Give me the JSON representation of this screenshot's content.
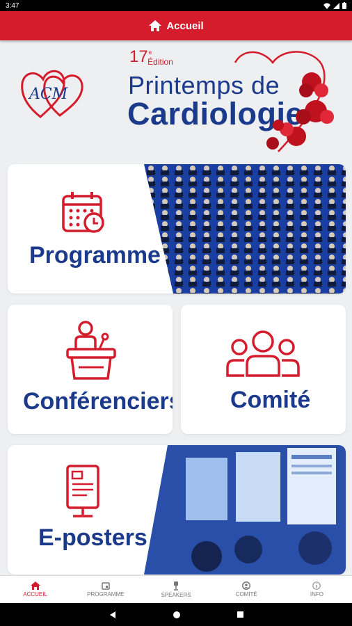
{
  "status_bar": {
    "time": "3:47"
  },
  "app_bar": {
    "title": "Accueil",
    "icon": "home-icon"
  },
  "banner": {
    "edition_number": "17",
    "edition_sup": "e",
    "edition_word": "Édition",
    "title_line1": "Printemps de",
    "title_line2": "Cardiologie",
    "logo_text": "ACM"
  },
  "cards": {
    "programme": {
      "label": "Programme",
      "icon": "calendar-clock-icon"
    },
    "conferenciers": {
      "label": "Conférenciers",
      "icon": "speaker-podium-icon"
    },
    "comite": {
      "label": "Comité",
      "icon": "group-icon"
    },
    "eposters": {
      "label": "E-posters",
      "icon": "poster-kiosk-icon"
    }
  },
  "bottom_nav": [
    {
      "label": "ACCUEIL",
      "icon": "home-icon",
      "active": true
    },
    {
      "label": "PROGRAMME",
      "icon": "calendar-icon",
      "active": false
    },
    {
      "label": "SPEAKERS",
      "icon": "microphone-icon",
      "active": false
    },
    {
      "label": "COMITÉ",
      "icon": "account-circle-icon",
      "active": false
    },
    {
      "label": "INFO",
      "icon": "info-icon",
      "active": false
    }
  ],
  "colors": {
    "primary_red": "#d41c2c",
    "navy": "#1b3a8c",
    "background": "#eeeff1"
  }
}
